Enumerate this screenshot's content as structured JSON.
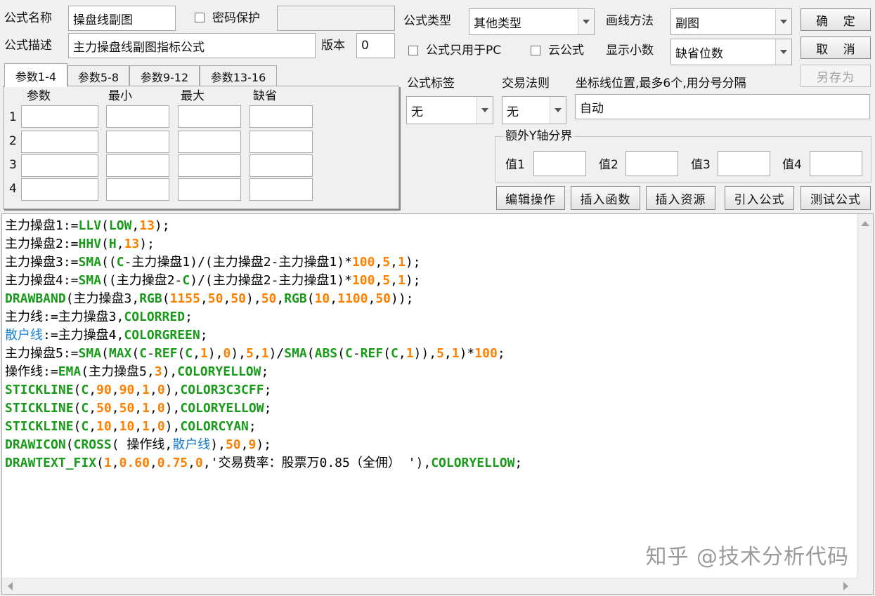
{
  "form": {
    "name_label": "公式名称",
    "name_value": "操盘线副图",
    "password_label": "密码保护",
    "desc_label": "公式描述",
    "desc_value": "主力操盘线副图指标公式",
    "version_label": "版本",
    "version_value": "0",
    "type_label": "公式类型",
    "type_value": "其他类型",
    "draw_label": "画线方法",
    "draw_value": "副图",
    "pc_only_label": "公式只用于PC",
    "cloud_label": "云公式",
    "decimals_label": "显示小数",
    "decimals_value": "缺省位数",
    "tag_label": "公式标签",
    "tag_value": "无",
    "rule_label": "交易法则",
    "rule_value": "无",
    "axis_label": "坐标线位置,最多6个,用分号分隔",
    "axis_value": "自动",
    "yaxis_group": "额外Y轴分界",
    "y1_label": "值1",
    "y2_label": "值2",
    "y3_label": "值3",
    "y4_label": "值4"
  },
  "buttons": {
    "ok": "确 定",
    "cancel": "取 消",
    "save_as": "另存为",
    "edit": "编辑操作",
    "insert_func": "插入函数",
    "insert_res": "插入资源",
    "import": "引入公式",
    "test": "测试公式"
  },
  "tabs": [
    "参数1-4",
    "参数5-8",
    "参数9-12",
    "参数13-16"
  ],
  "params": {
    "headers": [
      "参数",
      "最小",
      "最大",
      "缺省"
    ],
    "rows": [
      "1",
      "2",
      "3",
      "4"
    ]
  },
  "colors": {
    "func": "#1a9a1a",
    "num": "#ff8000",
    "blue": "#1a7fd0",
    "plain": "#000000"
  },
  "code_lines": [
    [
      [
        "n",
        "主力操盘1:="
      ],
      [
        "f",
        "LLV"
      ],
      [
        "n",
        "("
      ],
      [
        "f",
        "LOW"
      ],
      [
        "n",
        ","
      ],
      [
        "o",
        "13"
      ],
      [
        "n",
        ");"
      ]
    ],
    [
      [
        "n",
        "主力操盘2:="
      ],
      [
        "f",
        "HHV"
      ],
      [
        "n",
        "("
      ],
      [
        "f",
        "H"
      ],
      [
        "n",
        ","
      ],
      [
        "o",
        "13"
      ],
      [
        "n",
        ");"
      ]
    ],
    [
      [
        "n",
        "主力操盘3:="
      ],
      [
        "f",
        "SMA"
      ],
      [
        "n",
        "(("
      ],
      [
        "f",
        "C"
      ],
      [
        "n",
        "-主力操盘1)/(主力操盘2-主力操盘1)*"
      ],
      [
        "o",
        "100"
      ],
      [
        "n",
        ","
      ],
      [
        "o",
        "5"
      ],
      [
        "n",
        ","
      ],
      [
        "o",
        "1"
      ],
      [
        "n",
        ");"
      ]
    ],
    [
      [
        "n",
        "主力操盘4:="
      ],
      [
        "f",
        "SMA"
      ],
      [
        "n",
        "((主力操盘2-"
      ],
      [
        "f",
        "C"
      ],
      [
        "n",
        ")/(主力操盘2-主力操盘1)*"
      ],
      [
        "o",
        "100"
      ],
      [
        "n",
        ","
      ],
      [
        "o",
        "5"
      ],
      [
        "n",
        ","
      ],
      [
        "o",
        "1"
      ],
      [
        "n",
        ");"
      ]
    ],
    [
      [
        "f",
        "DRAWBAND"
      ],
      [
        "n",
        "(主力操盘3,"
      ],
      [
        "f",
        "RGB"
      ],
      [
        "n",
        "("
      ],
      [
        "o",
        "1155"
      ],
      [
        "n",
        ","
      ],
      [
        "o",
        "50"
      ],
      [
        "n",
        ","
      ],
      [
        "o",
        "50"
      ],
      [
        "n",
        "),"
      ],
      [
        "o",
        "50"
      ],
      [
        "n",
        ","
      ],
      [
        "f",
        "RGB"
      ],
      [
        "n",
        "("
      ],
      [
        "o",
        "10"
      ],
      [
        "n",
        ","
      ],
      [
        "o",
        "1100"
      ],
      [
        "n",
        ","
      ],
      [
        "o",
        "50"
      ],
      [
        "n",
        "));"
      ]
    ],
    [
      [
        "n",
        "主力线:=主力操盘3,"
      ],
      [
        "f",
        "COLORRED"
      ],
      [
        "n",
        ";"
      ]
    ],
    [
      [
        "b",
        "散户线"
      ],
      [
        "n",
        ":=主力操盘4,"
      ],
      [
        "f",
        "COLORGREEN"
      ],
      [
        "n",
        ";"
      ]
    ],
    [
      [
        "n",
        "主力操盘5:="
      ],
      [
        "f",
        "SMA"
      ],
      [
        "n",
        "("
      ],
      [
        "f",
        "MAX"
      ],
      [
        "n",
        "("
      ],
      [
        "f",
        "C"
      ],
      [
        "n",
        "-"
      ],
      [
        "f",
        "REF"
      ],
      [
        "n",
        "("
      ],
      [
        "f",
        "C"
      ],
      [
        "n",
        ","
      ],
      [
        "o",
        "1"
      ],
      [
        "n",
        "),"
      ],
      [
        "o",
        "0"
      ],
      [
        "n",
        "),"
      ],
      [
        "o",
        "5"
      ],
      [
        "n",
        ","
      ],
      [
        "o",
        "1"
      ],
      [
        "n",
        ")/"
      ],
      [
        "f",
        "SMA"
      ],
      [
        "n",
        "("
      ],
      [
        "f",
        "ABS"
      ],
      [
        "n",
        "("
      ],
      [
        "f",
        "C"
      ],
      [
        "n",
        "-"
      ],
      [
        "f",
        "REF"
      ],
      [
        "n",
        "("
      ],
      [
        "f",
        "C"
      ],
      [
        "n",
        ","
      ],
      [
        "o",
        "1"
      ],
      [
        "n",
        "))"
      ],
      [
        "n",
        ","
      ],
      [
        "o",
        "5"
      ],
      [
        "n",
        ","
      ],
      [
        "o",
        "1"
      ],
      [
        "n",
        ")*"
      ],
      [
        "o",
        "100"
      ],
      [
        "n",
        ";"
      ]
    ],
    [
      [
        "n",
        "操作线:="
      ],
      [
        "f",
        "EMA"
      ],
      [
        "n",
        "(主力操盘5,"
      ],
      [
        "o",
        "3"
      ],
      [
        "n",
        "),"
      ],
      [
        "f",
        "COLORYELLOW"
      ],
      [
        "n",
        ";"
      ]
    ],
    [
      [
        "f",
        "STICKLINE"
      ],
      [
        "n",
        "("
      ],
      [
        "f",
        "C"
      ],
      [
        "n",
        ","
      ],
      [
        "o",
        "90"
      ],
      [
        "n",
        ","
      ],
      [
        "o",
        "90"
      ],
      [
        "n",
        ","
      ],
      [
        "o",
        "1"
      ],
      [
        "n",
        ","
      ],
      [
        "o",
        "0"
      ],
      [
        "n",
        "),"
      ],
      [
        "f",
        "COLOR3C3CFF"
      ],
      [
        "n",
        ";"
      ]
    ],
    [
      [
        "f",
        "STICKLINE"
      ],
      [
        "n",
        "("
      ],
      [
        "f",
        "C"
      ],
      [
        "n",
        ","
      ],
      [
        "o",
        "50"
      ],
      [
        "n",
        ","
      ],
      [
        "o",
        "50"
      ],
      [
        "n",
        ","
      ],
      [
        "o",
        "1"
      ],
      [
        "n",
        ","
      ],
      [
        "o",
        "0"
      ],
      [
        "n",
        "),"
      ],
      [
        "f",
        "COLORYELLOW"
      ],
      [
        "n",
        ";"
      ]
    ],
    [
      [
        "f",
        "STICKLINE"
      ],
      [
        "n",
        "("
      ],
      [
        "f",
        "C"
      ],
      [
        "n",
        ","
      ],
      [
        "o",
        "10"
      ],
      [
        "n",
        ","
      ],
      [
        "o",
        "10"
      ],
      [
        "n",
        ","
      ],
      [
        "o",
        "1"
      ],
      [
        "n",
        ","
      ],
      [
        "o",
        "0"
      ],
      [
        "n",
        "),"
      ],
      [
        "f",
        "COLORCYAN"
      ],
      [
        "n",
        ";"
      ]
    ],
    [
      [
        "f",
        "DRAWICON"
      ],
      [
        "n",
        "("
      ],
      [
        "f",
        "CROSS"
      ],
      [
        "n",
        "( 操作线,"
      ],
      [
        "b",
        "散户线"
      ],
      [
        "n",
        "),"
      ],
      [
        "o",
        "50"
      ],
      [
        "n",
        ","
      ],
      [
        "o",
        "9"
      ],
      [
        "n",
        ");"
      ]
    ],
    [
      [
        "f",
        "DRAWTEXT_FIX"
      ],
      [
        "n",
        "("
      ],
      [
        "o",
        "1"
      ],
      [
        "n",
        ","
      ],
      [
        "o",
        "0.60"
      ],
      [
        "n",
        ","
      ],
      [
        "o",
        "0.75"
      ],
      [
        "n",
        ","
      ],
      [
        "o",
        "0"
      ],
      [
        "n",
        ",'交易费率：股票万0.85（全佣） '),"
      ],
      [
        "f",
        "COLORYELLOW"
      ],
      [
        "n",
        ";"
      ]
    ]
  ],
  "watermark": "知乎 @技术分析代码"
}
